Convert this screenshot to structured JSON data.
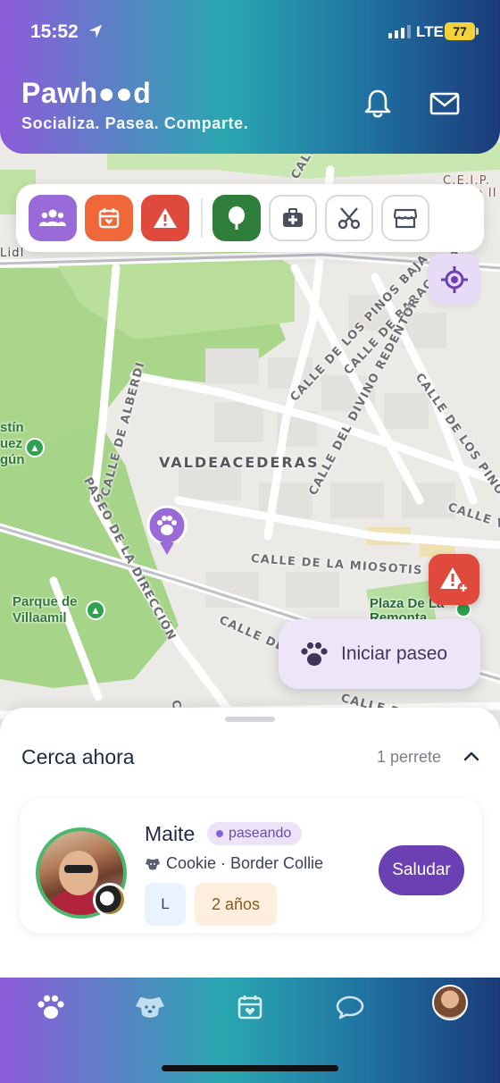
{
  "status_bar": {
    "time": "15:52",
    "network": "LTE",
    "battery": "77"
  },
  "header": {
    "brand": "Pawh●●d",
    "tagline": "Socializa. Pasea. Comparte.",
    "icons": [
      "bell-icon",
      "mail-icon"
    ]
  },
  "filters": {
    "items": [
      {
        "name": "people-filter",
        "icon": "people-icon",
        "color": "#9a6bd8"
      },
      {
        "name": "events-filter",
        "icon": "calendar-icon",
        "color": "#f0683a"
      },
      {
        "name": "alerts-filter",
        "icon": "warning-icon",
        "color": "#e04a3c"
      },
      {
        "name": "parks-filter",
        "icon": "tree-icon",
        "color": "#2f7f3a"
      },
      {
        "name": "vets-filter",
        "icon": "medkit-icon",
        "color": "#ffffff"
      },
      {
        "name": "grooming-filter",
        "icon": "scissors-icon",
        "color": "#ffffff"
      },
      {
        "name": "shops-filter",
        "icon": "store-icon",
        "color": "#ffffff"
      }
    ]
  },
  "map": {
    "district": "VALDEACEDERAS",
    "streets": [
      "CALLE DE ALBERDI",
      "PASEO DE LA DIRECCIÓN",
      "CALLE DE LOS PINOS BAJA",
      "CALLE DE BARACALDO",
      "CALLE DEL DIVINO REDENTOR",
      "CALLE DE LOS PINOS ALTA",
      "CALLE DE LA MIOSOTIS",
      "CALLE VE",
      "CALLE DEL M",
      "CALLE DE VIAN",
      "CALLE",
      "CALL",
      "CA"
    ],
    "places": {
      "park": "Parque de Villaamil",
      "plaza": "Plaza De La Remonta",
      "school": "C.E.I.P. Felipe II",
      "shop": "Lidl",
      "left_label": "stín uez gún"
    }
  },
  "start_walk": {
    "label": "Iniciar paseo"
  },
  "nearby": {
    "title": "Cerca ahora",
    "count": "1 perrete",
    "card": {
      "owner": "Maite",
      "status": "paseando",
      "dog": "Cookie · Border Collie",
      "size": "L",
      "age": "2 años",
      "action": "Saludar"
    }
  },
  "tabbar": {
    "items": [
      "paw-icon",
      "dog-icon",
      "calendar-heart-icon",
      "chat-icon",
      "profile-avatar"
    ]
  }
}
